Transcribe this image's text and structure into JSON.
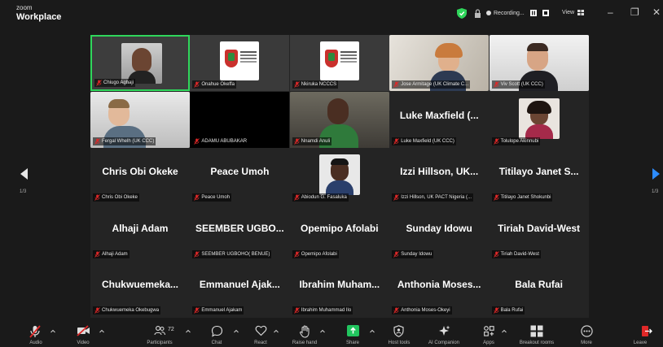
{
  "app": {
    "brand_top": "zoom",
    "brand_bottom": "Workplace"
  },
  "titlebar": {
    "recording_label": "Recording...",
    "view_label": "View"
  },
  "pagination": {
    "left": "1/3",
    "right": "1/3"
  },
  "participants": [
    {
      "label": "Chiugo Aghaji",
      "display": "",
      "kind": "video",
      "active": true
    },
    {
      "label": "Onahue Okeffa",
      "display": "",
      "kind": "logo"
    },
    {
      "label": "Nkiruka NCCCS",
      "display": "",
      "kind": "logo"
    },
    {
      "label": "Jose Armitage (UK Climate C...",
      "display": "",
      "kind": "video"
    },
    {
      "label": "Viv Scott (UK CCC)",
      "display": "",
      "kind": "video"
    },
    {
      "label": "Fergal Whelh (UK CCC)",
      "display": "",
      "kind": "video"
    },
    {
      "label": "ADAMU ABUBAKAR",
      "display": "",
      "kind": "black"
    },
    {
      "label": "Nnamdi Anuli",
      "display": "",
      "kind": "video"
    },
    {
      "label": "Luke Maxfield (UK CCC)",
      "display": "Luke Maxfield (...",
      "kind": "name"
    },
    {
      "label": "Tolulope Akinnubi",
      "display": "",
      "kind": "photo"
    },
    {
      "label": "Chris Obi Okeke",
      "display": "Chris Obi Okeke",
      "kind": "name"
    },
    {
      "label": "Peace Umoh",
      "display": "Peace Umoh",
      "kind": "name"
    },
    {
      "label": "Abiodun G. Fasaluka",
      "display": "",
      "kind": "photo"
    },
    {
      "label": "Izzi Hillson, UK PACT Nigeria (...",
      "display": "Izzi Hillson, UK...",
      "kind": "name"
    },
    {
      "label": "Titilayo Janet Shokunbi",
      "display": "Titilayo Janet S...",
      "kind": "name"
    },
    {
      "label": "Alhaji Adam",
      "display": "Alhaji Adam",
      "kind": "name"
    },
    {
      "label": "SEEMBER UGBOHO( BENUE)",
      "display": "SEEMBER UGBO...",
      "kind": "name"
    },
    {
      "label": "Opemipo Afolabi",
      "display": "Opemipo Afolabi",
      "kind": "name"
    },
    {
      "label": "Sunday Idowu",
      "display": "Sunday Idowu",
      "kind": "name"
    },
    {
      "label": "Tiriah David-West",
      "display": "Tiriah David-West",
      "kind": "name"
    },
    {
      "label": "Chukwuemeka Okebugwa",
      "display": "Chukwuemeka...",
      "kind": "name"
    },
    {
      "label": "Emmanuel Ajakam",
      "display": "Emmanuel Ajak...",
      "kind": "name"
    },
    {
      "label": "Ibrahim Muhammad Ilo",
      "display": "Ibrahim Muham...",
      "kind": "name"
    },
    {
      "label": "Anthonia Moses-Okeyi",
      "display": "Anthonia Moses...",
      "kind": "name"
    },
    {
      "label": "Bala Rufai",
      "display": "Bala Rufai",
      "kind": "name"
    }
  ],
  "toolbar": {
    "audio": "Audio",
    "video": "Video",
    "participants": "Participants",
    "participant_count": "72",
    "chat": "Chat",
    "react": "React",
    "raise_hand": "Raise hand",
    "share": "Share",
    "host_tools": "Host tools",
    "ai_companion": "AI Companion",
    "apps": "Apps",
    "breakout_rooms": "Breakout rooms",
    "more": "More",
    "leave": "Leave"
  },
  "colors": {
    "active_speaker": "#2fd65b",
    "share": "#21c55e",
    "leave": "#e02828",
    "nav_right": "#2d8cff"
  }
}
